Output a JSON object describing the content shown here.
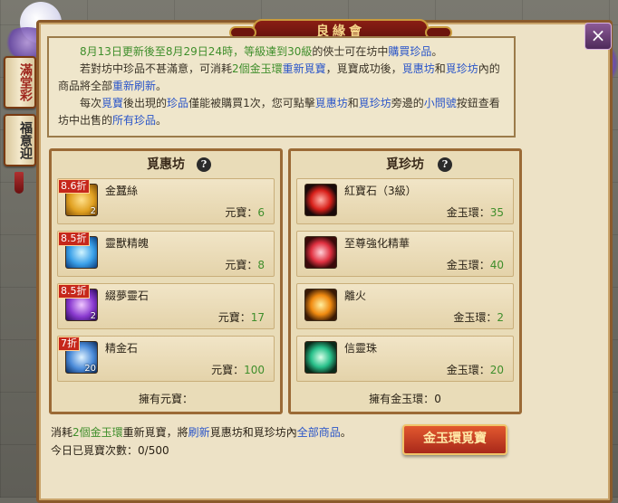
{
  "window": {
    "title": "良緣會",
    "close_label": "×"
  },
  "side_tabs": [
    {
      "label": "滿堂彩"
    },
    {
      "label": "福意迎"
    }
  ],
  "notice": {
    "line1_a": "8月13日更新後至8月29日24時，等級達到",
    "line1_b": "30級",
    "line1_c": "的俠士可在坊中",
    "line1_d": "購買珍品",
    "line1_e": "。",
    "line2_a": "若對坊中珍品不甚滿意，可消耗",
    "line2_b": "2個金玉環",
    "line2_c": "重新覓寶",
    "line2_d": "，覓寶成功後，",
    "line2_e": "覓惠坊",
    "line2_f": "和",
    "line2_g": "覓珍坊",
    "line2_h": "內的商品將全部",
    "line2_i": "重新刷新",
    "line2_j": "。",
    "line3_a": "每次",
    "line3_b": "覓寶",
    "line3_c": "後出現的",
    "line3_d": "珍品",
    "line3_e": "僅能被購買1次，您可點擊",
    "line3_f": "覓惠坊",
    "line3_g": "和",
    "line3_h": "覓珍坊",
    "line3_i": "旁邊的",
    "line3_j": "小問號",
    "line3_k": "按鈕查看坊中出售的",
    "line3_l": "所有珍品",
    "line3_m": "。"
  },
  "left_shop": {
    "title": "覓惠坊",
    "help_label": "?",
    "items": [
      {
        "name": "金蠶絲",
        "discount": "8.6折",
        "count": "2",
        "price_label": "元寶：",
        "price": "6",
        "icon": "gold-silk-icon",
        "icon_color": "#e0a020"
      },
      {
        "name": "靈獸精魄",
        "discount": "8.5折",
        "count": "",
        "price_label": "元寶：",
        "price": "8",
        "icon": "spirit-soul-icon",
        "icon_color": "#3aa0e8"
      },
      {
        "name": "綴夢靈石",
        "discount": "8.5折",
        "count": "2",
        "price_label": "元寶：",
        "price": "17",
        "icon": "dream-stone-icon",
        "icon_color": "#8a3ad0"
      },
      {
        "name": "精金石",
        "discount": "7折",
        "count": "20",
        "price_label": "元寶：",
        "price": "100",
        "icon": "gold-ore-icon",
        "icon_color": "#4a8ad8"
      }
    ],
    "footer_label": "擁有元寶："
  },
  "right_shop": {
    "title": "覓珍坊",
    "help_label": "?",
    "items": [
      {
        "name": "紅寶石（3級）",
        "price_label": "金玉環：",
        "price": "35",
        "icon": "ruby-icon",
        "icon_color": "#d8201a"
      },
      {
        "name": "至尊強化精華",
        "price_label": "金玉環：",
        "price": "40",
        "icon": "enhance-essence-icon",
        "icon_color": "#e03040"
      },
      {
        "name": "離火",
        "price_label": "金玉環：",
        "price": "2",
        "icon": "fire-icon",
        "icon_color": "#f08a10"
      },
      {
        "name": "信靈珠",
        "price_label": "金玉環：",
        "price": "20",
        "icon": "spirit-pearl-icon",
        "icon_color": "#28c08a"
      }
    ],
    "footer_label": "擁有金玉環：",
    "footer_value": "0"
  },
  "bottom": {
    "line1_a": "消耗",
    "line1_b": "2個金玉環",
    "line1_c": "重新覓寶，將",
    "line1_d": "刷新",
    "line1_e": "覓惠坊和覓珍坊內",
    "line1_f": "全部商品",
    "line1_g": "。",
    "line2_label": "今日已覓寶次數：",
    "line2_value": "0/500",
    "refresh_button": "金玉環覓寶"
  }
}
